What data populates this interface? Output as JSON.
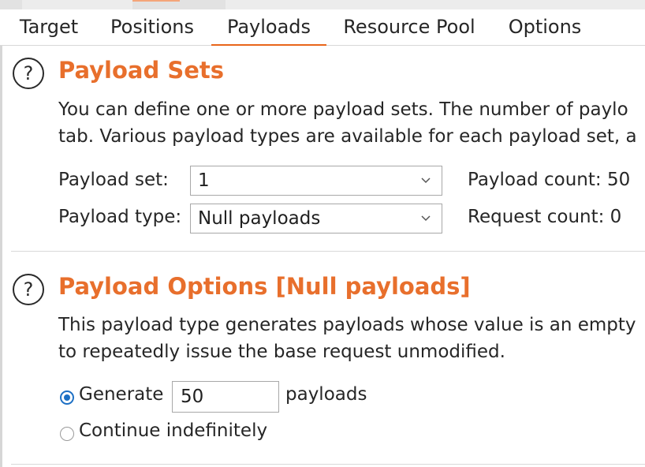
{
  "tabs": [
    {
      "label": "Target"
    },
    {
      "label": "Positions"
    },
    {
      "label": "Payloads",
      "active": true
    },
    {
      "label": "Resource Pool"
    },
    {
      "label": "Options"
    }
  ],
  "payload_sets": {
    "title": "Payload Sets",
    "description_line1": "You can define one or more payload sets. The number of paylo",
    "description_line2": "tab. Various payload types are available for each payload set, a",
    "set_label": "Payload set:",
    "set_value": "1",
    "type_label": "Payload type:",
    "type_value": "Null payloads",
    "payload_count": "Payload count: 50",
    "request_count": "Request count: 0"
  },
  "payload_options": {
    "title": "Payload Options [Null payloads]",
    "description_line1": "This payload type generates payloads whose value is an empty",
    "description_line2": "to repeatedly issue the base request unmodified.",
    "generate_label": "Generate",
    "generate_value": "50",
    "payloads_label": "payloads",
    "continue_label": "Continue indefinitely",
    "selected_mode": "generate"
  },
  "colors": {
    "accent": "#e86f2c",
    "tab_underline": "#e8651a",
    "radio_selected": "#1c6fc4"
  },
  "icons": {
    "help": "?"
  }
}
